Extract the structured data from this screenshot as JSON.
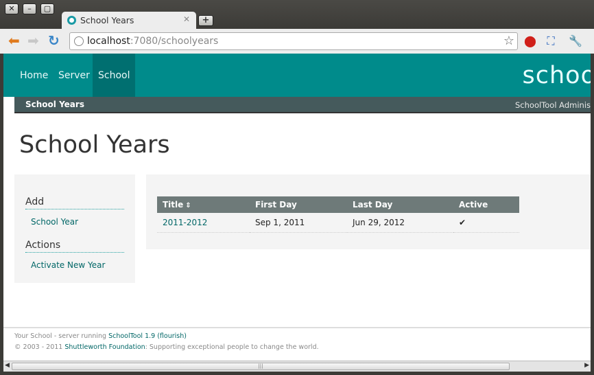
{
  "browser": {
    "tab_title": "School Years",
    "url_host": "localhost",
    "url_rest": ":7080/schoolyears",
    "win_close": "✕",
    "win_min": "–",
    "win_max": "▢",
    "new_tab": "+",
    "tab_close": "✕"
  },
  "topnav": {
    "items": [
      {
        "label": "Home"
      },
      {
        "label": "Server"
      },
      {
        "label": "School"
      }
    ],
    "active": "School",
    "brand": "schoo"
  },
  "subnav": {
    "left": "School Years",
    "right": "SchoolTool Administ"
  },
  "page": {
    "title": "School Years"
  },
  "sidebar": {
    "sections": [
      {
        "header": "Add",
        "links": [
          "School Year"
        ]
      },
      {
        "header": "Actions",
        "links": [
          "Activate New Year"
        ]
      }
    ]
  },
  "table": {
    "columns": [
      "Title",
      "First Day",
      "Last Day",
      "Active"
    ],
    "rows": [
      {
        "title": "2011-2012",
        "first_day": "Sep 1, 2011",
        "last_day": "Jun 29, 2012",
        "active": "✔"
      }
    ]
  },
  "footer": {
    "line1_prefix": "Your School - server running ",
    "line1_link": "SchoolTool 1.9 (flourish)",
    "line2_prefix": "© 2003 - 2011 ",
    "line2_link": "Shuttleworth Foundation",
    "line2_suffix": ": Supporting exceptional people to change the world."
  },
  "colors": {
    "accent": "#008b8b",
    "accent_dark": "#006f70",
    "subnav": "#455a5c",
    "link": "#006666"
  }
}
